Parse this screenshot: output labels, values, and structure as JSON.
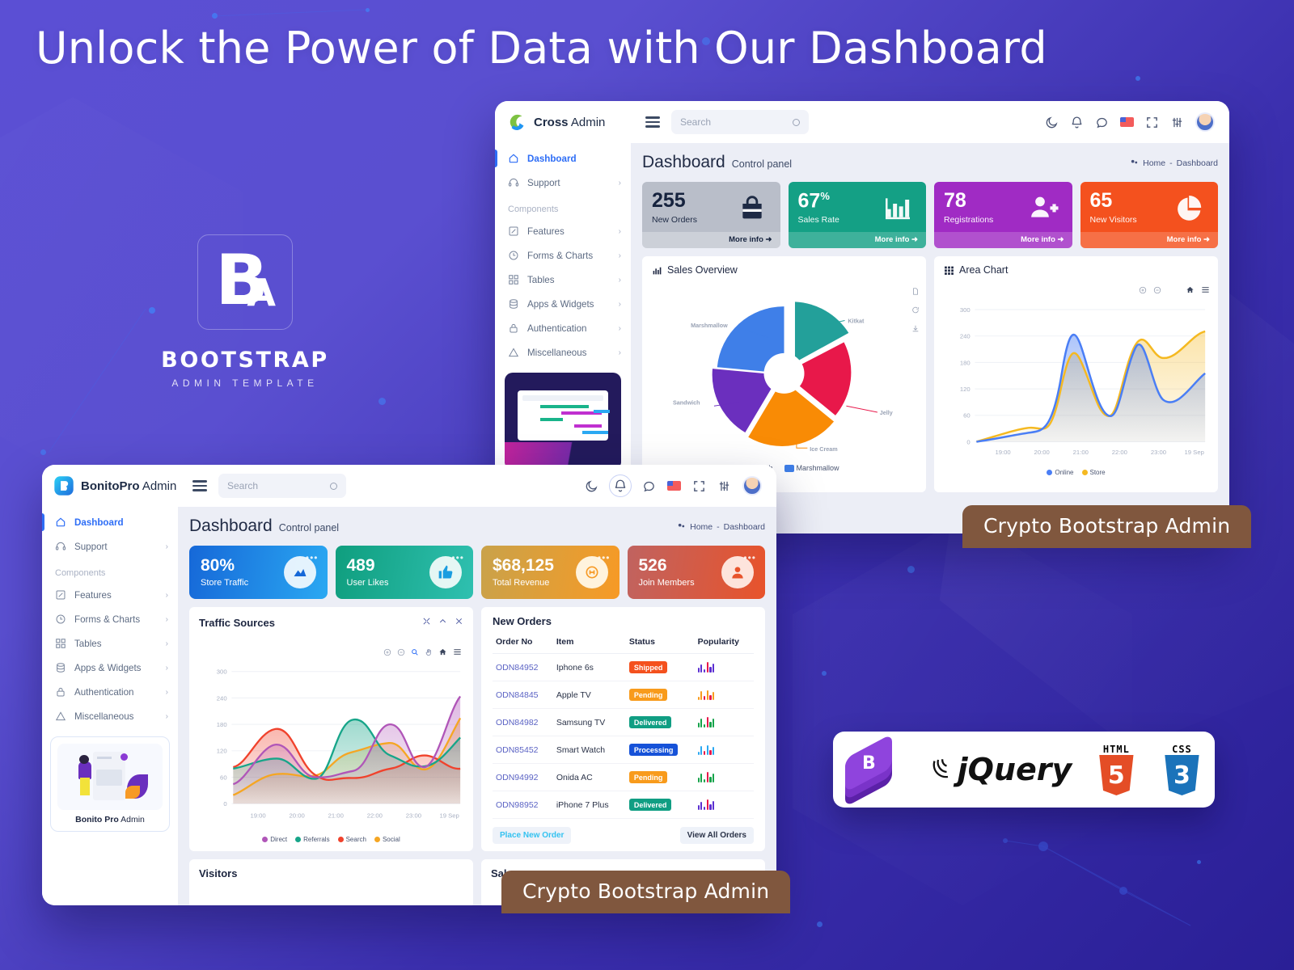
{
  "headline": "Unlock the Power of Data with Our Dashboard",
  "brand_block": {
    "mark_letter_b": "B",
    "mark_letter_a": "A",
    "title": "BOOTSTRAP",
    "subtitle": "ADMIN TEMPLATE"
  },
  "ribbons": {
    "top": "Crypto Bootstrap Admin",
    "bottom": "Crypto Bootstrap Admin"
  },
  "tech_strip": {
    "items": [
      {
        "name": "bootstrap-logo",
        "label": "B"
      },
      {
        "name": "jquery-logo",
        "label": "jQuery"
      },
      {
        "name": "html5-logo",
        "label": "HTML",
        "digit": "5",
        "color": "#e44d26"
      },
      {
        "name": "css3-logo",
        "label": "CSS",
        "digit": "3",
        "color": "#1b73ba"
      }
    ]
  },
  "cross_admin": {
    "brand": {
      "bold": "Cross",
      "light": " Admin"
    },
    "search": {
      "placeholder": "Search"
    },
    "topbar_icons": [
      "moon-icon",
      "bell-icon",
      "chat-icon",
      "flag-icon",
      "fullscreen-icon",
      "settings-sliders-icon",
      "avatar"
    ],
    "sidebar": {
      "items": [
        {
          "label": "Dashboard",
          "icon": "home-icon",
          "active": true,
          "chevron": ""
        },
        {
          "label": "Support",
          "icon": "headset-icon",
          "active": false,
          "chevron": "›"
        }
      ],
      "group_label": "Components",
      "group_items": [
        {
          "label": "Features",
          "icon": "edit-icon",
          "chevron": "›"
        },
        {
          "label": "Forms & Charts",
          "icon": "clock-icon",
          "chevron": "›"
        },
        {
          "label": "Tables",
          "icon": "grid-icon",
          "chevron": "›"
        },
        {
          "label": "Apps & Widgets",
          "icon": "database-icon",
          "chevron": "›"
        },
        {
          "label": "Authentication",
          "icon": "lock-icon",
          "chevron": "›"
        },
        {
          "label": "Miscellaneous",
          "icon": "warning-icon",
          "chevron": "›"
        }
      ]
    },
    "page": {
      "title": "Dashboard",
      "subtitle": "Control panel"
    },
    "breadcrumb": {
      "home": "Home",
      "sep": "-",
      "current": "Dashboard",
      "icon": "dashboard-icon"
    },
    "stats": [
      {
        "value": "255",
        "suffix": "",
        "label": "New Orders",
        "more": "More info",
        "color": "#b9bec9",
        "icon": "bag-icon"
      },
      {
        "value": "67",
        "suffix": "%",
        "label": "Sales Rate",
        "more": "More info",
        "color": "#14a085",
        "icon": "bar-chart-icon"
      },
      {
        "value": "78",
        "suffix": "",
        "label": "Registrations",
        "more": "More info",
        "color": "#a02bc4",
        "icon": "user-plus-icon"
      },
      {
        "value": "65",
        "suffix": "",
        "label": "New Visitors",
        "more": "More info",
        "color": "#f4511e",
        "icon": "pie-chart-icon"
      }
    ],
    "sales_overview": {
      "title": "Sales Overview",
      "icon": "bar-chart-icon",
      "tools": [
        "document-icon",
        "refresh-icon",
        "download-icon"
      ],
      "legend": [
        {
          "label": "Sandwich",
          "color": "#6b2fbe"
        },
        {
          "label": "Marshmallow",
          "color": "#3f7fe8"
        }
      ]
    },
    "area_chart": {
      "title": "Area Chart",
      "icon": "grid-icon",
      "tools": [
        "zoom-in-icon",
        "zoom-out-icon",
        "home-icon",
        "menu-icon"
      ]
    }
  },
  "bonito_admin": {
    "brand": {
      "bold": "BonitoPro",
      "light": " Admin"
    },
    "search": {
      "placeholder": "Search"
    },
    "topbar_icons": [
      "moon-icon",
      "bell-icon",
      "chat-icon",
      "flag-icon",
      "fullscreen-icon",
      "settings-sliders-icon",
      "avatar"
    ],
    "sidebar": {
      "items": [
        {
          "label": "Dashboard",
          "icon": "home-icon",
          "active": true,
          "chevron": ""
        },
        {
          "label": "Support",
          "icon": "headset-icon",
          "active": false,
          "chevron": "›"
        }
      ],
      "group_label": "Components",
      "group_items": [
        {
          "label": "Features",
          "icon": "edit-icon",
          "chevron": "›"
        },
        {
          "label": "Forms & Charts",
          "icon": "clock-icon",
          "chevron": "›"
        },
        {
          "label": "Tables",
          "icon": "grid-icon",
          "chevron": "›"
        },
        {
          "label": "Apps & Widgets",
          "icon": "database-icon",
          "chevron": "›"
        },
        {
          "label": "Authentication",
          "icon": "lock-icon",
          "chevron": "›"
        },
        {
          "label": "Miscellaneous",
          "icon": "warning-icon",
          "chevron": "›"
        }
      ],
      "promo": {
        "bold": "Bonito Pro",
        "light": " Admin"
      }
    },
    "page": {
      "title": "Dashboard",
      "subtitle": "Control panel"
    },
    "breadcrumb": {
      "home": "Home",
      "sep": "-",
      "current": "Dashboard",
      "icon": "dashboard-icon"
    },
    "stats": [
      {
        "value": "80%",
        "label": "Store Traffic",
        "icon": "area-chart-icon",
        "c1": "#1668d8",
        "c2": "#2aa8f2"
      },
      {
        "value": "489",
        "label": "User Likes",
        "icon": "thumbs-up-icon",
        "c1": "#0f9e7e",
        "c2": "#2fc0b0"
      },
      {
        "value": "$68,125",
        "label": "Total Revenue",
        "icon": "coin-icon",
        "c1": "#c9a24a",
        "c2": "#f79a25"
      },
      {
        "value": "526",
        "label": "Join Members",
        "icon": "user-icon",
        "c1": "#c06360",
        "c2": "#e8532b"
      }
    ],
    "traffic_sources": {
      "title": "Traffic Sources",
      "window_tools": [
        "expand-icon",
        "collapse-icon",
        "close-icon"
      ],
      "chart_tools": [
        "zoom-in-icon",
        "zoom-out-icon",
        "zoom-selection-icon",
        "pan-icon",
        "home-icon",
        "menu-icon"
      ]
    },
    "new_orders": {
      "title": "New Orders",
      "columns": [
        "Order No",
        "Item",
        "Status",
        "Popularity"
      ],
      "rows": [
        {
          "order": "ODN84952",
          "item": "Iphone 6s",
          "status": "Shipped",
          "status_color": "#f4511e",
          "spark_color": "#5b2fd1"
        },
        {
          "order": "ODN84845",
          "item": "Apple TV",
          "status": "Pending",
          "status_color": "#f89b1c",
          "spark_color": "#f89b1c"
        },
        {
          "order": "ODN84982",
          "item": "Samsung TV",
          "status": "Delivered",
          "status_color": "#109e83",
          "spark_color": "#16a34a"
        },
        {
          "order": "ODN85452",
          "item": "Smart Watch",
          "status": "Processing",
          "status_color": "#1652d8",
          "spark_color": "#2aa8f2"
        },
        {
          "order": "ODN94992",
          "item": "Onida AC",
          "status": "Pending",
          "status_color": "#f89b1c",
          "spark_color": "#16a34a"
        },
        {
          "order": "ODN98952",
          "item": "iPhone 7 Plus",
          "status": "Delivered",
          "status_color": "#109e83",
          "spark_color": "#5b2fd1"
        }
      ],
      "place_order_label": "Place New Order",
      "view_all_label": "View All Orders"
    },
    "visitors_panel": {
      "title": "Visitors"
    },
    "sales_panel": {
      "title": "Sales"
    }
  },
  "chart_data": [
    {
      "name": "sales_overview_pie",
      "type": "pie",
      "title": "Sales Overview",
      "categories": [
        "Kitkat",
        "Jelly",
        "Ice Cream",
        "Sandwich",
        "Marshmallow"
      ],
      "values": [
        28,
        17,
        21,
        17,
        17
      ],
      "colors": [
        "#23a09a",
        "#e8184a",
        "#f98b05",
        "#6b2fbe",
        "#3f7fe8"
      ],
      "labels_shown": [
        "Marshmallow",
        "Kitkat",
        "Jelly",
        "Ice Cream",
        "Sandwich"
      ],
      "legend": [
        "Sandwich",
        "Marshmallow"
      ],
      "legend_position": "bottom",
      "donut": true
    },
    {
      "name": "area_chart",
      "type": "area",
      "title": "Area Chart",
      "x": [
        "19:00",
        "20:00",
        "21:00",
        "22:00",
        "23:00",
        "19 Sep"
      ],
      "ylim": [
        0,
        300
      ],
      "yticks": [
        0,
        60,
        120,
        180,
        240,
        300
      ],
      "grid": true,
      "legend_position": "bottom",
      "series": [
        {
          "name": "Online",
          "color": "#4a7ef5",
          "values": [
            18,
            30,
            210,
            80,
            210,
            82,
            150
          ]
        },
        {
          "name": "Store",
          "color": "#f5b921",
          "values": [
            38,
            48,
            160,
            40,
            45,
            190,
            250
          ]
        }
      ]
    },
    {
      "name": "traffic_sources",
      "type": "area",
      "title": "Traffic Sources",
      "x": [
        "19:00",
        "20:00",
        "21:00",
        "22:00",
        "23:00",
        "19 Sep"
      ],
      "ylim": [
        0,
        300
      ],
      "yticks": [
        0,
        60,
        120,
        180,
        240,
        300
      ],
      "grid": true,
      "legend_position": "bottom",
      "series": [
        {
          "name": "Direct",
          "color": "#b056b8",
          "values": [
            45,
            128,
            70,
            70,
            178,
            105,
            250
          ]
        },
        {
          "name": "Referrals",
          "color": "#17a589",
          "values": [
            80,
            100,
            58,
            200,
            148,
            105,
            150
          ]
        },
        {
          "name": "Search",
          "color": "#f0422c",
          "values": [
            82,
            188,
            78,
            58,
            78,
            110,
            80
          ]
        },
        {
          "name": "Social",
          "color": "#f5a623",
          "values": [
            20,
            80,
            68,
            118,
            138,
            82,
            200
          ]
        }
      ]
    }
  ]
}
